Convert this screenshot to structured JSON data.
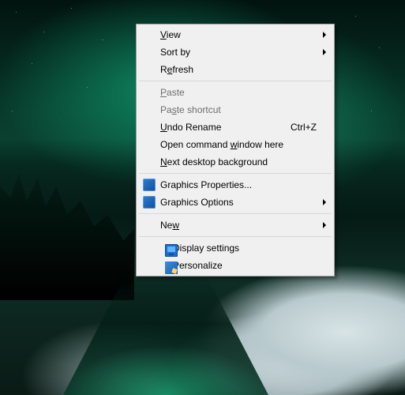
{
  "menu": {
    "view": {
      "label_pre": "",
      "label_u": "V",
      "label_post": "iew"
    },
    "sort": {
      "label": "Sort by"
    },
    "refresh": {
      "label_pre": "R",
      "label_u": "e",
      "label_post": "fresh"
    },
    "paste": {
      "label_pre": "",
      "label_u": "P",
      "label_post": "aste"
    },
    "paste_shortcut": {
      "label_pre": "Pa",
      "label_u": "s",
      "label_post": "te shortcut"
    },
    "undo_rename": {
      "label_pre": "",
      "label_u": "U",
      "label_post": "ndo Rename",
      "shortcut": "Ctrl+Z"
    },
    "open_cmd": {
      "label_pre": "Open command ",
      "label_u": "w",
      "label_post": "indow here"
    },
    "next_bg": {
      "label_pre": "",
      "label_u": "N",
      "label_post": "ext desktop background"
    },
    "gfx_props": {
      "label": "Graphics Properties..."
    },
    "gfx_opts": {
      "label": "Graphics Options"
    },
    "new": {
      "label_pre": "Ne",
      "label_u": "w",
      "label_post": ""
    },
    "display_settings": {
      "label": "Display settings"
    },
    "personalize": {
      "label": "Personalize"
    }
  }
}
